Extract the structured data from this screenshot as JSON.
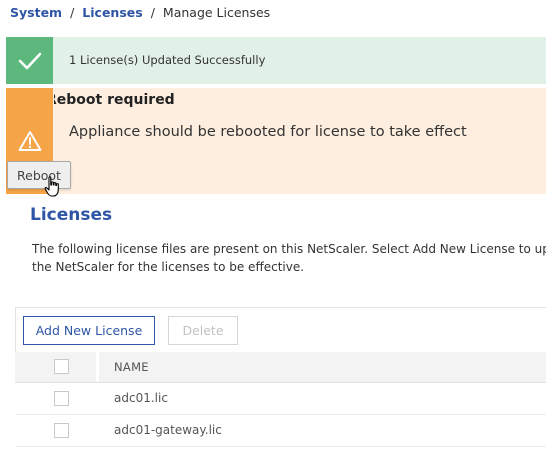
{
  "breadcrumb": {
    "items": [
      "System",
      "Licenses"
    ],
    "separator": "/",
    "current": "Manage Licenses"
  },
  "alerts": {
    "success": {
      "message": "1 License(s) Updated Successfully",
      "icon": "check-icon",
      "color": "#5cb87d",
      "background": "#e2f1e7"
    },
    "warning": {
      "title": "Reboot required",
      "message": "Appliance should be rebooted for license to take effect",
      "icon": "warning-triangle-icon",
      "color": "#f5a447",
      "background": "#fdeedf",
      "button_label": "Reboot"
    }
  },
  "licenses": {
    "title": "Licenses",
    "description_lines": [
      "The following license files are present on this NetScaler. Select Add New License to uplo",
      "the NetScaler for the licenses to be effective."
    ],
    "toolbar": {
      "add_label": "Add New License",
      "delete_label": "Delete"
    },
    "table": {
      "columns": [
        "NAME"
      ],
      "rows": [
        {
          "name": "adc01.lic"
        },
        {
          "name": "adc01-gateway.lic"
        }
      ]
    }
  },
  "accent_color": "#2f56a6"
}
